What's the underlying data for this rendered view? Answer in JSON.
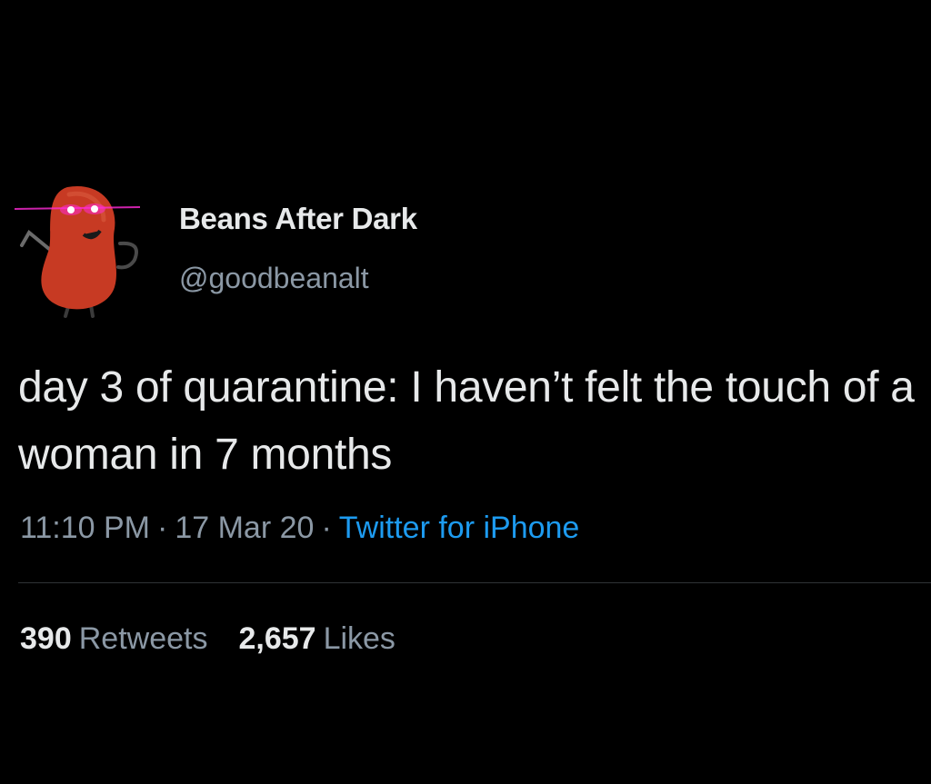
{
  "colors": {
    "background": "#000000",
    "primary_text": "#e7e9ea",
    "secondary_text": "#8b98a5",
    "link": "#1d9bf0",
    "divider": "#2f3336",
    "avatar_bean": "#c73a23",
    "avatar_eye_glow": "#ff2bd6"
  },
  "author": {
    "avatar_icon": "bean-mascot-icon",
    "display_name": "Beans After Dark",
    "handle": "@goodbeanalt"
  },
  "tweet": {
    "text": "day 3 of quarantine: I haven’t felt the touch of a woman in 7 months",
    "time": "11:10 PM",
    "date": "17 Mar 20",
    "separator": "·",
    "source": "Twitter for iPhone"
  },
  "stats": {
    "retweets_count": "390",
    "retweets_label": "Retweets",
    "likes_count": "2,657",
    "likes_label": "Likes"
  }
}
